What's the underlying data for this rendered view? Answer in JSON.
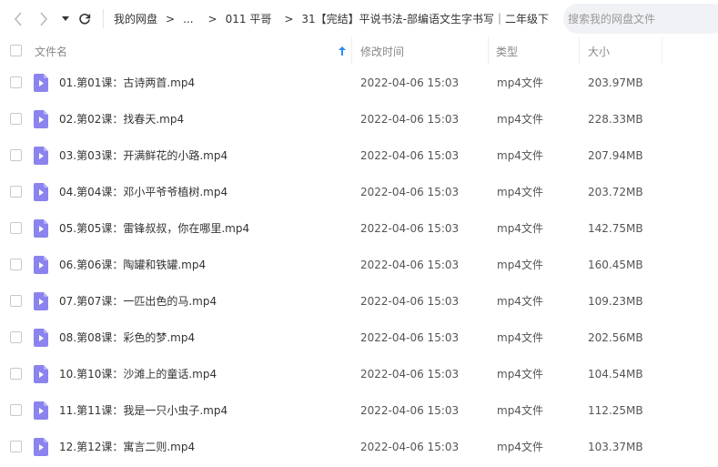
{
  "toolbar": {
    "breadcrumb": [
      "我的网盘",
      "...",
      "011 平哥",
      "31【完结】平说书法-部编语文生字书写｜二年级下"
    ],
    "separator": ">",
    "trailing_separator": ">",
    "search_placeholder": "搜索我的网盘文件"
  },
  "columns": {
    "name": "文件名",
    "modified": "修改时间",
    "type": "类型",
    "size": "大小"
  },
  "colors": {
    "accent": "#2a8cf0",
    "icon": "#8b84ee",
    "icon_fold": "#b7b2f6"
  },
  "files": [
    {
      "name": "01.第01课：古诗两首.mp4",
      "modified": "2022-04-06 15:03",
      "type": "mp4文件",
      "size": "203.97MB"
    },
    {
      "name": "02.第02课：找春天.mp4",
      "modified": "2022-04-06 15:03",
      "type": "mp4文件",
      "size": "228.33MB"
    },
    {
      "name": "03.第03课：开满鲜花的小路.mp4",
      "modified": "2022-04-06 15:03",
      "type": "mp4文件",
      "size": "207.94MB"
    },
    {
      "name": "04.第04课：邓小平爷爷植树.mp4",
      "modified": "2022-04-06 15:03",
      "type": "mp4文件",
      "size": "203.72MB"
    },
    {
      "name": "05.第05课：雷锋叔叔，你在哪里.mp4",
      "modified": "2022-04-06 15:03",
      "type": "mp4文件",
      "size": "142.75MB"
    },
    {
      "name": "06.第06课：陶罐和铁罐.mp4",
      "modified": "2022-04-06 15:03",
      "type": "mp4文件",
      "size": "160.45MB"
    },
    {
      "name": "07.第07课：一匹出色的马.mp4",
      "modified": "2022-04-06 15:03",
      "type": "mp4文件",
      "size": "109.23MB"
    },
    {
      "name": "08.第08课：彩色的梦.mp4",
      "modified": "2022-04-06 15:03",
      "type": "mp4文件",
      "size": "202.56MB"
    },
    {
      "name": "10.第10课：沙滩上的童话.mp4",
      "modified": "2022-04-06 15:03",
      "type": "mp4文件",
      "size": "104.54MB"
    },
    {
      "name": "11.第11课：我是一只小虫子.mp4",
      "modified": "2022-04-06 15:03",
      "type": "mp4文件",
      "size": "112.25MB"
    },
    {
      "name": "12.第12课：寓言二则.mp4",
      "modified": "2022-04-06 15:03",
      "type": "mp4文件",
      "size": "103.37MB"
    }
  ]
}
